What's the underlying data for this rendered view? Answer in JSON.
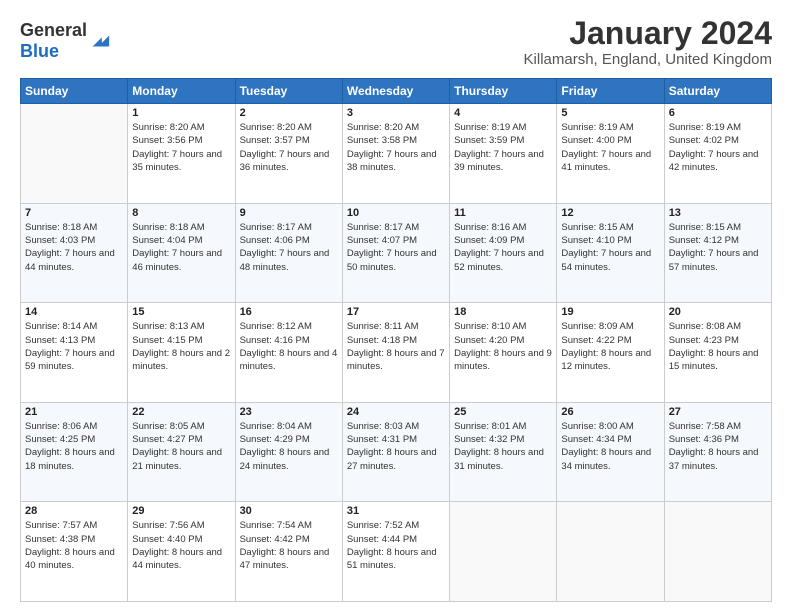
{
  "logo": {
    "general": "General",
    "blue": "Blue"
  },
  "header": {
    "month": "January 2024",
    "location": "Killamarsh, England, United Kingdom"
  },
  "days": [
    "Sunday",
    "Monday",
    "Tuesday",
    "Wednesday",
    "Thursday",
    "Friday",
    "Saturday"
  ],
  "weeks": [
    [
      {
        "day": "",
        "sunrise": "",
        "sunset": "",
        "daylight": ""
      },
      {
        "day": "1",
        "sunrise": "Sunrise: 8:20 AM",
        "sunset": "Sunset: 3:56 PM",
        "daylight": "Daylight: 7 hours and 35 minutes."
      },
      {
        "day": "2",
        "sunrise": "Sunrise: 8:20 AM",
        "sunset": "Sunset: 3:57 PM",
        "daylight": "Daylight: 7 hours and 36 minutes."
      },
      {
        "day": "3",
        "sunrise": "Sunrise: 8:20 AM",
        "sunset": "Sunset: 3:58 PM",
        "daylight": "Daylight: 7 hours and 38 minutes."
      },
      {
        "day": "4",
        "sunrise": "Sunrise: 8:19 AM",
        "sunset": "Sunset: 3:59 PM",
        "daylight": "Daylight: 7 hours and 39 minutes."
      },
      {
        "day": "5",
        "sunrise": "Sunrise: 8:19 AM",
        "sunset": "Sunset: 4:00 PM",
        "daylight": "Daylight: 7 hours and 41 minutes."
      },
      {
        "day": "6",
        "sunrise": "Sunrise: 8:19 AM",
        "sunset": "Sunset: 4:02 PM",
        "daylight": "Daylight: 7 hours and 42 minutes."
      }
    ],
    [
      {
        "day": "7",
        "sunrise": "Sunrise: 8:18 AM",
        "sunset": "Sunset: 4:03 PM",
        "daylight": "Daylight: 7 hours and 44 minutes."
      },
      {
        "day": "8",
        "sunrise": "Sunrise: 8:18 AM",
        "sunset": "Sunset: 4:04 PM",
        "daylight": "Daylight: 7 hours and 46 minutes."
      },
      {
        "day": "9",
        "sunrise": "Sunrise: 8:17 AM",
        "sunset": "Sunset: 4:06 PM",
        "daylight": "Daylight: 7 hours and 48 minutes."
      },
      {
        "day": "10",
        "sunrise": "Sunrise: 8:17 AM",
        "sunset": "Sunset: 4:07 PM",
        "daylight": "Daylight: 7 hours and 50 minutes."
      },
      {
        "day": "11",
        "sunrise": "Sunrise: 8:16 AM",
        "sunset": "Sunset: 4:09 PM",
        "daylight": "Daylight: 7 hours and 52 minutes."
      },
      {
        "day": "12",
        "sunrise": "Sunrise: 8:15 AM",
        "sunset": "Sunset: 4:10 PM",
        "daylight": "Daylight: 7 hours and 54 minutes."
      },
      {
        "day": "13",
        "sunrise": "Sunrise: 8:15 AM",
        "sunset": "Sunset: 4:12 PM",
        "daylight": "Daylight: 7 hours and 57 minutes."
      }
    ],
    [
      {
        "day": "14",
        "sunrise": "Sunrise: 8:14 AM",
        "sunset": "Sunset: 4:13 PM",
        "daylight": "Daylight: 7 hours and 59 minutes."
      },
      {
        "day": "15",
        "sunrise": "Sunrise: 8:13 AM",
        "sunset": "Sunset: 4:15 PM",
        "daylight": "Daylight: 8 hours and 2 minutes."
      },
      {
        "day": "16",
        "sunrise": "Sunrise: 8:12 AM",
        "sunset": "Sunset: 4:16 PM",
        "daylight": "Daylight: 8 hours and 4 minutes."
      },
      {
        "day": "17",
        "sunrise": "Sunrise: 8:11 AM",
        "sunset": "Sunset: 4:18 PM",
        "daylight": "Daylight: 8 hours and 7 minutes."
      },
      {
        "day": "18",
        "sunrise": "Sunrise: 8:10 AM",
        "sunset": "Sunset: 4:20 PM",
        "daylight": "Daylight: 8 hours and 9 minutes."
      },
      {
        "day": "19",
        "sunrise": "Sunrise: 8:09 AM",
        "sunset": "Sunset: 4:22 PM",
        "daylight": "Daylight: 8 hours and 12 minutes."
      },
      {
        "day": "20",
        "sunrise": "Sunrise: 8:08 AM",
        "sunset": "Sunset: 4:23 PM",
        "daylight": "Daylight: 8 hours and 15 minutes."
      }
    ],
    [
      {
        "day": "21",
        "sunrise": "Sunrise: 8:06 AM",
        "sunset": "Sunset: 4:25 PM",
        "daylight": "Daylight: 8 hours and 18 minutes."
      },
      {
        "day": "22",
        "sunrise": "Sunrise: 8:05 AM",
        "sunset": "Sunset: 4:27 PM",
        "daylight": "Daylight: 8 hours and 21 minutes."
      },
      {
        "day": "23",
        "sunrise": "Sunrise: 8:04 AM",
        "sunset": "Sunset: 4:29 PM",
        "daylight": "Daylight: 8 hours and 24 minutes."
      },
      {
        "day": "24",
        "sunrise": "Sunrise: 8:03 AM",
        "sunset": "Sunset: 4:31 PM",
        "daylight": "Daylight: 8 hours and 27 minutes."
      },
      {
        "day": "25",
        "sunrise": "Sunrise: 8:01 AM",
        "sunset": "Sunset: 4:32 PM",
        "daylight": "Daylight: 8 hours and 31 minutes."
      },
      {
        "day": "26",
        "sunrise": "Sunrise: 8:00 AM",
        "sunset": "Sunset: 4:34 PM",
        "daylight": "Daylight: 8 hours and 34 minutes."
      },
      {
        "day": "27",
        "sunrise": "Sunrise: 7:58 AM",
        "sunset": "Sunset: 4:36 PM",
        "daylight": "Daylight: 8 hours and 37 minutes."
      }
    ],
    [
      {
        "day": "28",
        "sunrise": "Sunrise: 7:57 AM",
        "sunset": "Sunset: 4:38 PM",
        "daylight": "Daylight: 8 hours and 40 minutes."
      },
      {
        "day": "29",
        "sunrise": "Sunrise: 7:56 AM",
        "sunset": "Sunset: 4:40 PM",
        "daylight": "Daylight: 8 hours and 44 minutes."
      },
      {
        "day": "30",
        "sunrise": "Sunrise: 7:54 AM",
        "sunset": "Sunset: 4:42 PM",
        "daylight": "Daylight: 8 hours and 47 minutes."
      },
      {
        "day": "31",
        "sunrise": "Sunrise: 7:52 AM",
        "sunset": "Sunset: 4:44 PM",
        "daylight": "Daylight: 8 hours and 51 minutes."
      },
      {
        "day": "",
        "sunrise": "",
        "sunset": "",
        "daylight": ""
      },
      {
        "day": "",
        "sunrise": "",
        "sunset": "",
        "daylight": ""
      },
      {
        "day": "",
        "sunrise": "",
        "sunset": "",
        "daylight": ""
      }
    ]
  ]
}
